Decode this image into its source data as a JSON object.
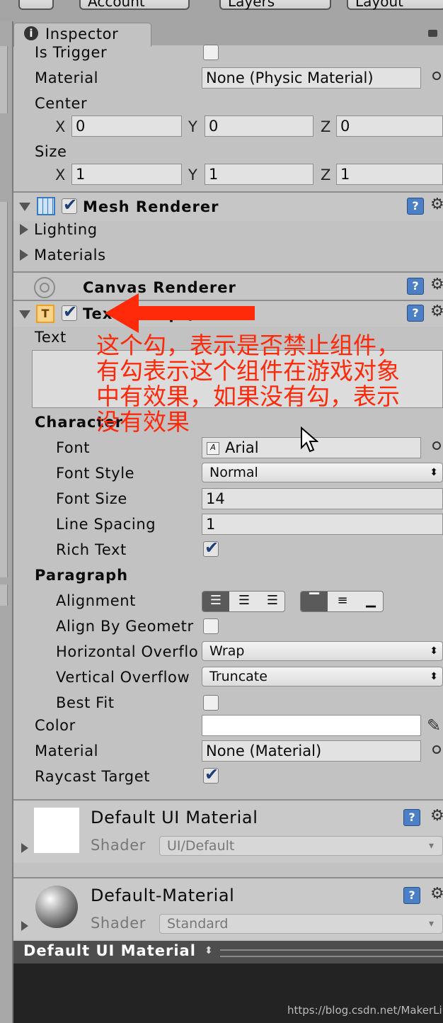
{
  "toolbar": {
    "account": "Account",
    "layers": "Layers",
    "layout": "Layout"
  },
  "inspector": {
    "tab_label": "Inspector"
  },
  "box_collider": {
    "is_trigger_label": "Is Trigger",
    "material_label": "Material",
    "material_value": "None (Physic Material)",
    "center_label": "Center",
    "size_label": "Size",
    "axis_x": "X",
    "axis_y": "Y",
    "axis_z": "Z",
    "center": {
      "x": "0",
      "y": "0",
      "z": "0"
    },
    "size": {
      "x": "1",
      "y": "1",
      "z": "1"
    }
  },
  "mesh_renderer": {
    "title": "Mesh Renderer",
    "lighting": "Lighting",
    "materials": "Materials"
  },
  "canvas_renderer": {
    "title": "Canvas Renderer"
  },
  "text_component": {
    "title": "Text (Script)",
    "text_label": "Text",
    "character_header": "Character",
    "font_label": "Font",
    "font_value": "Arial",
    "font_style_label": "Font Style",
    "font_style_value": "Normal",
    "font_size_label": "Font Size",
    "font_size_value": "14",
    "line_spacing_label": "Line Spacing",
    "line_spacing_value": "1",
    "rich_text_label": "Rich Text",
    "paragraph_header": "Paragraph",
    "alignment_label": "Alignment",
    "align_by_geometry_label": "Align By Geometr",
    "horizontal_overflow_label": "Horizontal Overflo",
    "horizontal_overflow_value": "Wrap",
    "vertical_overflow_label": "Vertical Overflow",
    "vertical_overflow_value": "Truncate",
    "best_fit_label": "Best Fit",
    "color_label": "Color",
    "material_label": "Material",
    "material_value": "None (Material)",
    "raycast_target_label": "Raycast Target"
  },
  "material_previews": [
    {
      "name": "Default UI Material",
      "shader_label": "Shader",
      "shader_value": "UI/Default"
    },
    {
      "name": "Default-Material",
      "shader_label": "Shader",
      "shader_value": "Standard"
    }
  ],
  "preview_bar": {
    "title": "Default UI Material"
  },
  "annotation": {
    "line1": "这个勾，表示是否禁止组件，",
    "line2": "有勾表示这个组件在游戏对象",
    "line3": "中有效果，如果没有勾，表示",
    "line4": "没有效果",
    "color": "#ff2a0a"
  },
  "watermark": "https://blog.csdn.net/MakerLiu"
}
